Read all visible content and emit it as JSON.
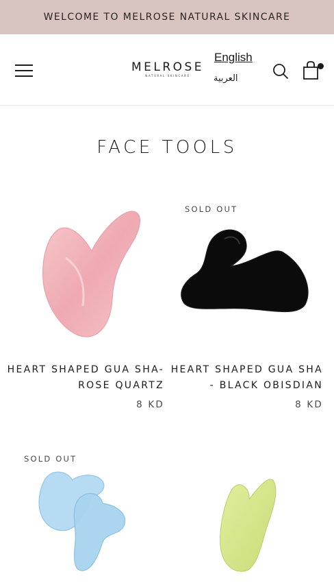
{
  "announcement": {
    "text": "WELCOME TO MELROSE NATURAL SKINCARE"
  },
  "header": {
    "logo_main": "MELROSE",
    "logo_sub": "NATURAL SKINCARE",
    "lang_english": "English",
    "lang_arabic": "العربية"
  },
  "page": {
    "title": "FACE TOOLS"
  },
  "products": [
    {
      "title": "HEART SHAPED GUA SHA- ROSE QUARTZ",
      "price": "8 KD",
      "sold_out": "",
      "color": "#f2b9c0"
    },
    {
      "title": "HEART SHAPED GUA SHA - BLACK OBISDIAN",
      "price": "8 KD",
      "sold_out": "SOLD OUT",
      "color": "#0b0b0b"
    },
    {
      "title": "",
      "price": "",
      "sold_out": "SOLD OUT",
      "color": "#a9d6f2"
    },
    {
      "title": "",
      "price": "",
      "sold_out": "",
      "color": "#d6e68a"
    }
  ],
  "colors": {
    "announcement_bg": "#d8c5bf",
    "text": "#1c1b1b"
  }
}
